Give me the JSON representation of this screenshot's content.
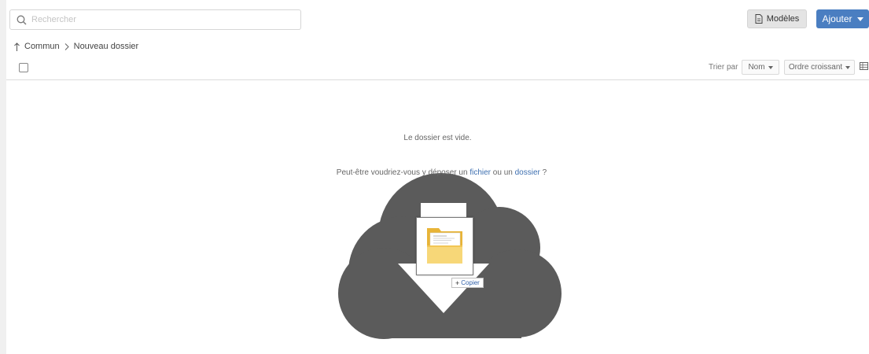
{
  "search": {
    "placeholder": "Rechercher"
  },
  "toolbar": {
    "models_label": "Modèles",
    "add_label": "Ajouter"
  },
  "breadcrumb": {
    "root": "Commun",
    "current": "Nouveau dossier"
  },
  "sort": {
    "label": "Trier par",
    "field": "Nom",
    "order": "Ordre croissant"
  },
  "empty": {
    "message": "Le dossier est vide.",
    "hint_prefix": "Peut-être voudriez-vous y déposer un",
    "link_file": "fichier",
    "hint_middle": "ou un",
    "link_folder": "dossier",
    "hint_suffix": "?"
  },
  "drag": {
    "copy_label": "Copier"
  },
  "colors": {
    "accent": "#4a7ec1",
    "link": "#3d6fb0",
    "cloud": "#5b5b5b",
    "folder": "#f7c948"
  }
}
